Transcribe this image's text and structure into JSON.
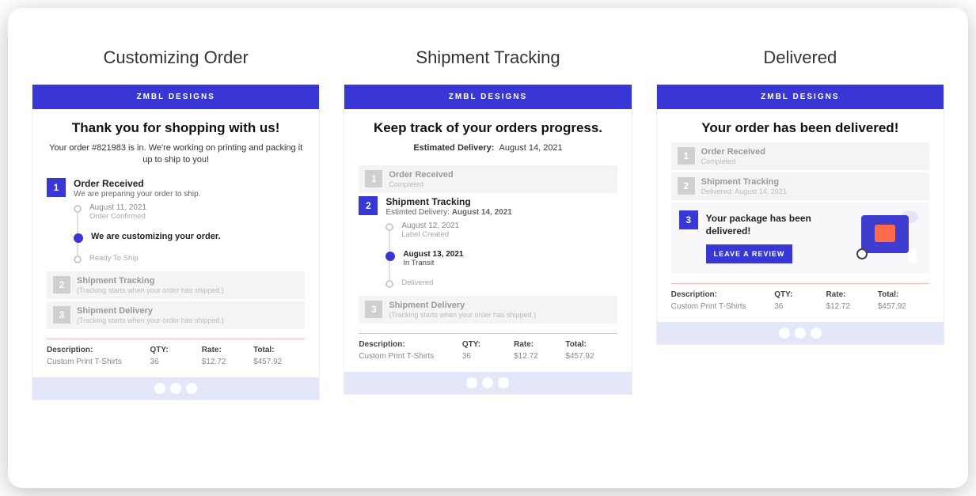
{
  "brand": "ZMBL DESIGNS",
  "columns": {
    "customizing": {
      "title": "Customizing Order",
      "headline": "Thank you for shopping with us!",
      "subtext": "Your order #821983 is in. We're working on printing and packing it up to ship to you!",
      "step1": {
        "num": "1",
        "title": "Order Received",
        "sub": "We are preparing your order to ship."
      },
      "timeline": [
        {
          "date": "August 11, 2021",
          "label": "Order Confirmed",
          "filled": false,
          "dateStrong": false,
          "labelStrong": false
        },
        {
          "date": "",
          "label": "We are customizing your order.",
          "filled": true,
          "dateStrong": false,
          "labelStrong": true
        },
        {
          "date": "",
          "label": "Ready To Ship",
          "filled": false,
          "dateStrong": false,
          "labelStrong": false
        }
      ],
      "step2": {
        "num": "2",
        "title": "Shipment Tracking",
        "sub": "(Tracking starts when your order has shipped.)"
      },
      "step3": {
        "num": "3",
        "title": "Shipment Delivery",
        "sub": "(Tracking starts when your order has shipped.)"
      }
    },
    "tracking": {
      "title": "Shipment Tracking",
      "headline": "Keep track of your orders progress.",
      "estLabel": "Estimated Delivery:",
      "estDate": "August 14, 2021",
      "step1": {
        "num": "1",
        "title": "Order Received",
        "sub": "Completed"
      },
      "step2": {
        "num": "2",
        "title": "Shipment Tracking",
        "sub_prefix": "Estimted Delivery:",
        "sub_bold": "August 14, 2021"
      },
      "timeline": [
        {
          "date": "August 12, 2021",
          "label": "Label Created",
          "filled": false,
          "dateStrong": false,
          "labelStrong": false
        },
        {
          "date": "August 13, 2021",
          "label": "In Transit",
          "filled": true,
          "dateStrong": true,
          "labelStrong": false
        },
        {
          "date": "",
          "label": "Delivered",
          "filled": false,
          "dateStrong": false,
          "labelStrong": false
        }
      ],
      "step3": {
        "num": "3",
        "title": "Shipment Delivery",
        "sub": "(Tracking starts when your order has shipped.)"
      }
    },
    "delivered": {
      "title": "Delivered",
      "headline": "Your order has been delivered!",
      "step1": {
        "num": "1",
        "title": "Order Received",
        "sub": "Completed"
      },
      "step2": {
        "num": "2",
        "title": "Shipment Tracking",
        "sub": "Delivered: August 14, 2021"
      },
      "step3": {
        "num": "3",
        "msg": "Your package has been delivered!",
        "btn": "LEAVE A REVIEW"
      }
    }
  },
  "order_table": {
    "headers": {
      "desc": "Description:",
      "qty": "QTY:",
      "rate": "Rate:",
      "total": "Total:"
    },
    "row": {
      "desc": "Custom Print T-Shirts",
      "qty": "36",
      "rate": "$12.72",
      "total": "$457.92"
    }
  }
}
